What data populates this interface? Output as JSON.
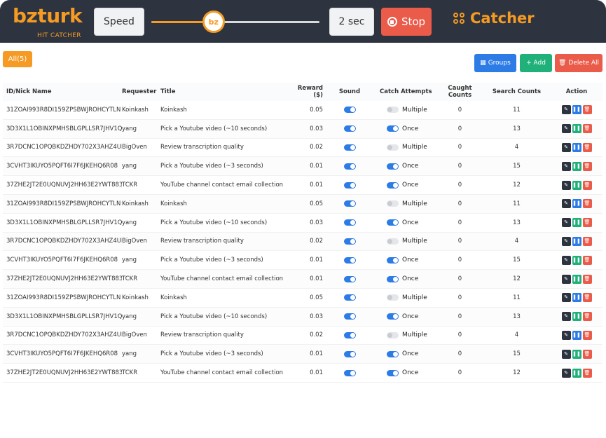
{
  "header": {
    "logo_main": "bzturk",
    "logo_sub": "HIT CATCHER",
    "speed_label": "Speed",
    "slider_knob_label": "bz",
    "slider_value": 0.37,
    "interval_value": "2 sec",
    "stop_label": "Stop",
    "catcher_title": "Catcher"
  },
  "toolbar": {
    "all_label": "All(5)",
    "groups_label": "Groups",
    "add_label": "+ Add",
    "delete_all_label": "Delete All"
  },
  "table": {
    "headers": [
      "ID/Nick Name",
      "Requester",
      "Title",
      "Reward ($)",
      "Sound",
      "Catch Attempts",
      "Caught Counts",
      "Search Counts",
      "Action"
    ],
    "rows": [
      {
        "id": "31ZOAI993R8DI159ZPSBWJROHCYTLN",
        "requester": "Koinkash",
        "title": "Koinkash",
        "reward": "0.05",
        "sound": true,
        "catch_on": false,
        "catch": "Multiple",
        "caught": "0",
        "search": "11",
        "pause_style": "blue"
      },
      {
        "id": "3D3X1L1OBINXPMHSBLGPLLSR7JHV1Q",
        "requester": "yang",
        "title": "Pick a Youtube video (~10 seconds)",
        "reward": "0.03",
        "sound": true,
        "catch_on": true,
        "catch": "Once",
        "caught": "0",
        "search": "13",
        "pause_style": "green"
      },
      {
        "id": "3R7DCNC1OPQBKDZHDY702X3AHZ4UDJ",
        "requester": "BigOven",
        "title": "Review transcription quality",
        "reward": "0.02",
        "sound": true,
        "catch_on": false,
        "catch": "Multiple",
        "caught": "0",
        "search": "4",
        "pause_style": "blue"
      },
      {
        "id": "3CVHT3IKUYO5PQFT6I7F6JKEHQ6R08",
        "requester": "yang",
        "title": "Pick a Youtube video (~3 seconds)",
        "reward": "0.01",
        "sound": true,
        "catch_on": true,
        "catch": "Once",
        "caught": "0",
        "search": "15",
        "pause_style": "green"
      },
      {
        "id": "37ZHE2JT2E0UQNUVJ2HH63E2YWT883",
        "requester": "TCKR",
        "title": "YouTube channel contact email collection",
        "reward": "0.01",
        "sound": true,
        "catch_on": true,
        "catch": "Once",
        "caught": "0",
        "search": "12",
        "pause_style": "green"
      },
      {
        "id": "31ZOAI993R8DI159ZPSBWJROHCYTLN",
        "requester": "Koinkash",
        "title": "Koinkash",
        "reward": "0.05",
        "sound": true,
        "catch_on": false,
        "catch": "Multiple",
        "caught": "0",
        "search": "11",
        "pause_style": "blue"
      },
      {
        "id": "3D3X1L1OBINXPMHSBLGPLLSR7JHV1Q",
        "requester": "yang",
        "title": "Pick a Youtube video (~10 seconds)",
        "reward": "0.03",
        "sound": true,
        "catch_on": true,
        "catch": "Once",
        "caught": "0",
        "search": "13",
        "pause_style": "green"
      },
      {
        "id": "3R7DCNC1OPQBKDZHDY702X3AHZ4UDJ",
        "requester": "BigOven",
        "title": "Review transcription quality",
        "reward": "0.02",
        "sound": true,
        "catch_on": false,
        "catch": "Multiple",
        "caught": "0",
        "search": "4",
        "pause_style": "blue"
      },
      {
        "id": "3CVHT3IKUYO5PQFT6I7F6JKEHQ6R08",
        "requester": "yang",
        "title": "Pick a Youtube video (~3 seconds)",
        "reward": "0.01",
        "sound": true,
        "catch_on": true,
        "catch": "Once",
        "caught": "0",
        "search": "15",
        "pause_style": "green"
      },
      {
        "id": "37ZHE2JT2E0UQNUVJ2HH63E2YWT883",
        "requester": "TCKR",
        "title": "YouTube channel contact email collection",
        "reward": "0.01",
        "sound": true,
        "catch_on": true,
        "catch": "Once",
        "caught": "0",
        "search": "12",
        "pause_style": "green"
      },
      {
        "id": "31ZOAI993R8DI159ZPSBWJROHCYTLN",
        "requester": "Koinkash",
        "title": "Koinkash",
        "reward": "0.05",
        "sound": true,
        "catch_on": false,
        "catch": "Multiple",
        "caught": "0",
        "search": "11",
        "pause_style": "blue"
      },
      {
        "id": "3D3X1L1OBINXPMHSBLGPLLSR7JHV1Q",
        "requester": "yang",
        "title": "Pick a Youtube video (~10 seconds)",
        "reward": "0.03",
        "sound": true,
        "catch_on": true,
        "catch": "Once",
        "caught": "0",
        "search": "13",
        "pause_style": "green"
      },
      {
        "id": "3R7DCNC1OPQBKDZHDY702X3AHZ4UDJ",
        "requester": "BigOven",
        "title": "Review transcription quality",
        "reward": "0.02",
        "sound": true,
        "catch_on": false,
        "catch": "Multiple",
        "caught": "0",
        "search": "4",
        "pause_style": "blue"
      },
      {
        "id": "3CVHT3IKUYO5PQFT6I7F6JKEHQ6R08",
        "requester": "yang",
        "title": "Pick a Youtube video (~3 seconds)",
        "reward": "0.01",
        "sound": true,
        "catch_on": true,
        "catch": "Once",
        "caught": "0",
        "search": "15",
        "pause_style": "green"
      },
      {
        "id": "37ZHE2JT2E0UQNUVJ2HH63E2YWT883",
        "requester": "TCKR",
        "title": "YouTube channel contact email collection",
        "reward": "0.01",
        "sound": true,
        "catch_on": true,
        "catch": "Once",
        "caught": "0",
        "search": "12",
        "pause_style": "green"
      }
    ]
  },
  "colors": {
    "header_bg": "#2d3440",
    "accent_orange": "#f59a23",
    "blue": "#2d7be5",
    "green": "#20b07a",
    "red": "#ea5b4a"
  },
  "icons": {
    "edit": "pencil-icon",
    "pause": "pause-icon",
    "trash": "trash-icon",
    "catcher": "grid-icon",
    "stop": "stop-icon"
  }
}
